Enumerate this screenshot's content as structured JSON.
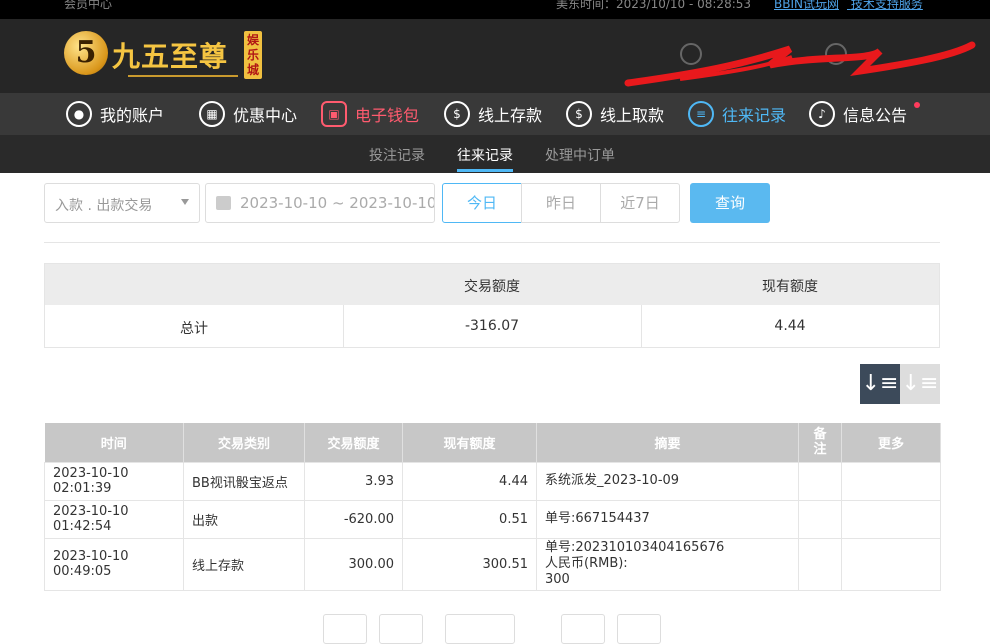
{
  "topbar": {
    "member_center": "会员中心",
    "time_label": "美东时间：2023/10/10 - 08:28:53",
    "link1": "BBIN试玩网",
    "link2": "技术支持服务"
  },
  "header": {
    "logo_name": "九五至尊",
    "logo_tag": "娱乐城",
    "logo_num": "5"
  },
  "nav": {
    "items": [
      {
        "label": "我的账户"
      },
      {
        "label": "优惠中心"
      },
      {
        "label": "电子钱包"
      },
      {
        "label": "线上存款"
      },
      {
        "label": "线上取款"
      },
      {
        "label": "往来记录"
      },
      {
        "label": "信息公告"
      }
    ]
  },
  "subnav": {
    "tabs": [
      {
        "label": "投注记录"
      },
      {
        "label": "往来记录"
      },
      {
        "label": "处理中订单"
      }
    ]
  },
  "filters": {
    "type_select": "入款 . 出款交易",
    "date_range": "2023-10-10 ~ 2023-10-10",
    "today": "今日",
    "yesterday": "昨日",
    "last7": "近7日",
    "search": "查询"
  },
  "summary": {
    "col_amount": "交易额度",
    "col_balance": "现有额度",
    "row_label": "总计",
    "amount": "-316.07",
    "balance": "4.44"
  },
  "records": {
    "headers": [
      "时间",
      "交易类别",
      "交易额度",
      "现有额度",
      "摘要",
      "备注",
      "更多"
    ],
    "rows": [
      {
        "time": "2023-10-10 02:01:39",
        "type": "BB视讯骰宝返点",
        "amount": "3.93",
        "balance": "4.44",
        "memo": "系统派发_2023-10-09",
        "memo2": "",
        "memo3": ""
      },
      {
        "time": "2023-10-10 01:42:54",
        "type": "出款",
        "amount": "-620.00",
        "balance": "0.51",
        "memo": "单号:667154437",
        "memo2": "",
        "memo3": ""
      },
      {
        "time": "2023-10-10 00:49:05",
        "type": "线上存款",
        "amount": "300.00",
        "balance": "300.51",
        "memo": "单号:202310103404165676",
        "memo2": "人民币(RMB):",
        "memo3": "300"
      }
    ]
  }
}
